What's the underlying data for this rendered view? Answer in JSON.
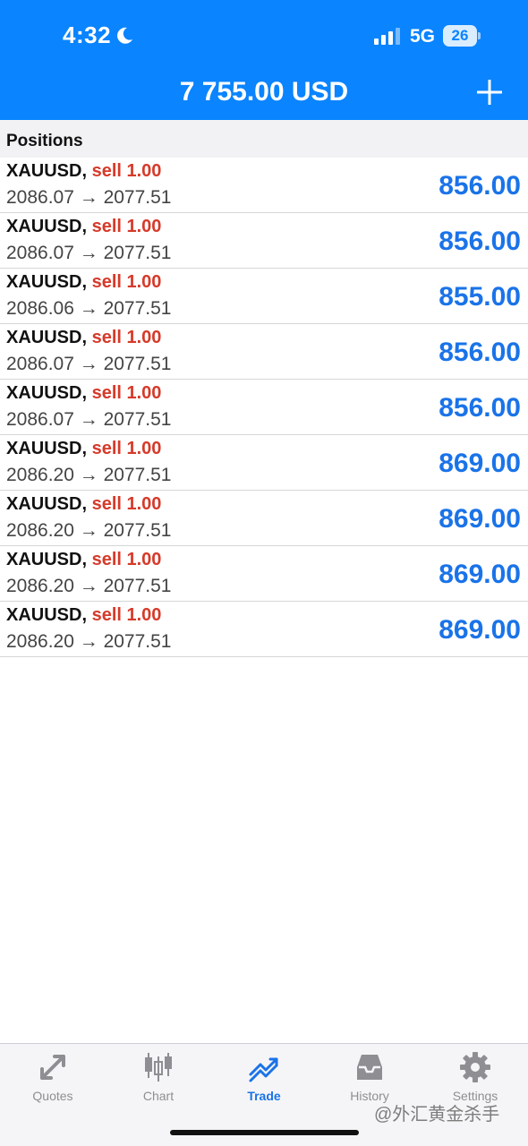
{
  "status_bar": {
    "time": "4:32",
    "network": "5G",
    "battery": "26"
  },
  "header": {
    "balance": "7 755.00 USD"
  },
  "section": {
    "title": "Positions"
  },
  "positions": [
    {
      "symbol": "XAUUSD,",
      "side": "sell 1.00",
      "prices": "2086.07 → 2077.51",
      "profit": "856.00"
    },
    {
      "symbol": "XAUUSD,",
      "side": "sell 1.00",
      "prices": "2086.07 → 2077.51",
      "profit": "856.00"
    },
    {
      "symbol": "XAUUSD,",
      "side": "sell 1.00",
      "prices": "2086.06 → 2077.51",
      "profit": "855.00"
    },
    {
      "symbol": "XAUUSD,",
      "side": "sell 1.00",
      "prices": "2086.07 → 2077.51",
      "profit": "856.00"
    },
    {
      "symbol": "XAUUSD,",
      "side": "sell 1.00",
      "prices": "2086.07 → 2077.51",
      "profit": "856.00"
    },
    {
      "symbol": "XAUUSD,",
      "side": "sell 1.00",
      "prices": "2086.20 → 2077.51",
      "profit": "869.00"
    },
    {
      "symbol": "XAUUSD,",
      "side": "sell 1.00",
      "prices": "2086.20 → 2077.51",
      "profit": "869.00"
    },
    {
      "symbol": "XAUUSD,",
      "side": "sell 1.00",
      "prices": "2086.20 → 2077.51",
      "profit": "869.00"
    },
    {
      "symbol": "XAUUSD,",
      "side": "sell 1.00",
      "prices": "2086.20 → 2077.51",
      "profit": "869.00"
    }
  ],
  "tabs": [
    {
      "label": "Quotes",
      "icon": "quotes-arrows-icon",
      "active": false
    },
    {
      "label": "Chart",
      "icon": "candlestick-icon",
      "active": false
    },
    {
      "label": "Trade",
      "icon": "trade-trend-icon",
      "active": true
    },
    {
      "label": "History",
      "icon": "inbox-tray-icon",
      "active": false
    },
    {
      "label": "Settings",
      "icon": "gear-icon",
      "active": false
    }
  ],
  "watermark": "@外汇黄金杀手",
  "colors": {
    "header": "#0a84ff",
    "sell": "#d63a2a",
    "profit": "#1a73e8",
    "tab_inactive": "#8e8e93",
    "tab_active": "#1a73e8"
  }
}
